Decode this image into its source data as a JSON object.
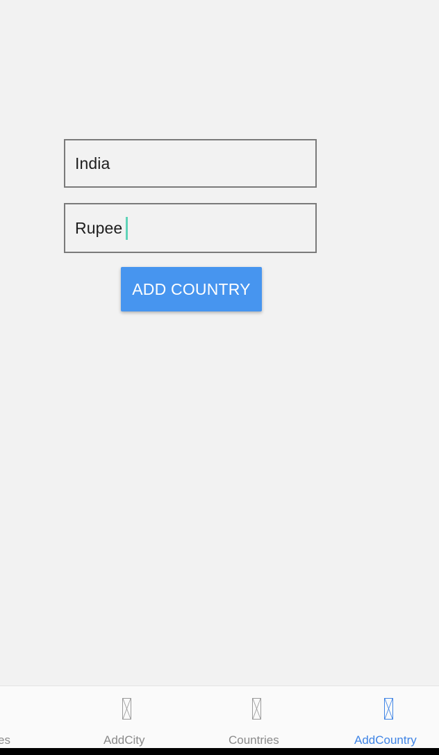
{
  "form": {
    "country_name_value": "India",
    "currency_value": "Rupee",
    "submit_label": "ADD COUNTRY"
  },
  "bottom_nav": {
    "tabs": [
      {
        "label": "es",
        "icon": "placeholder-icon",
        "active": false
      },
      {
        "label": "AddCity",
        "icon": "placeholder-icon",
        "active": false
      },
      {
        "label": "Countries",
        "icon": "placeholder-icon",
        "active": false
      },
      {
        "label": "AddCountry",
        "icon": "placeholder-icon",
        "active": true
      }
    ]
  },
  "colors": {
    "background": "#f2f2f2",
    "accent": "#4795ef",
    "active_tab": "#3f84e5",
    "inactive_tab": "#8a8a8a",
    "cursor": "#5fd3b8"
  }
}
